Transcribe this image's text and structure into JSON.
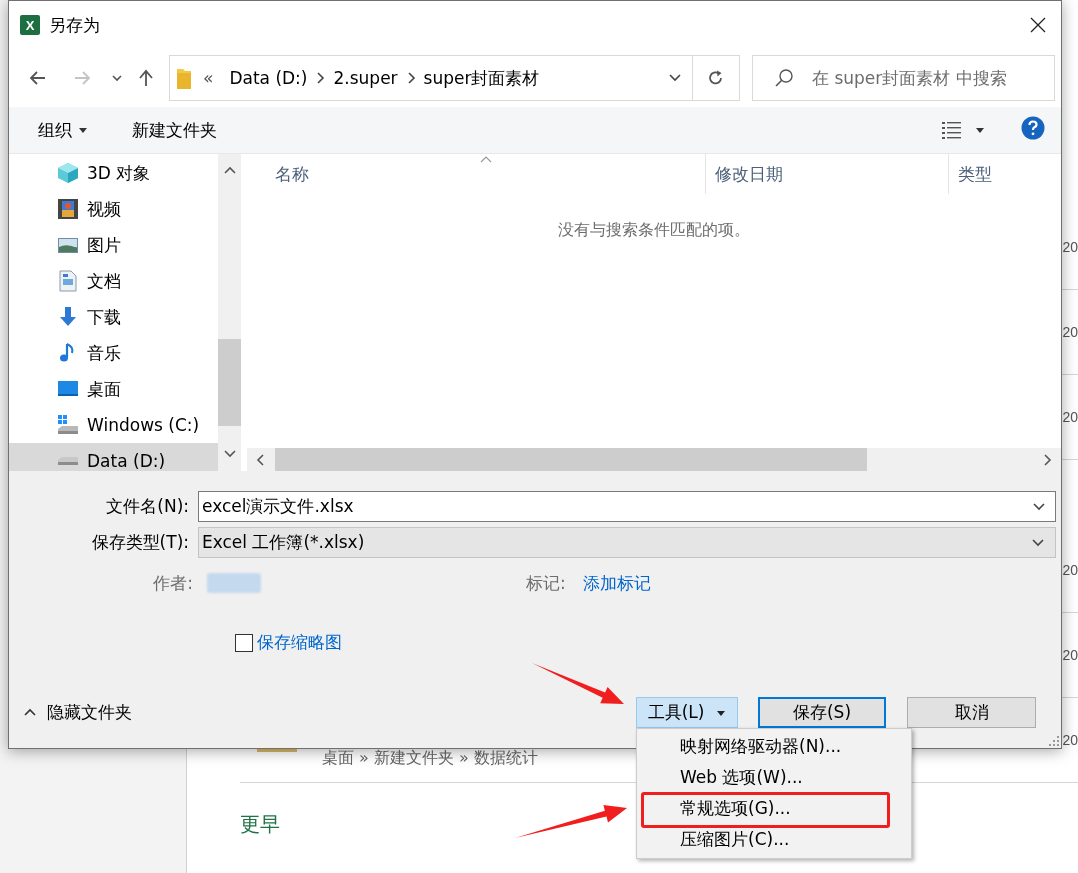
{
  "window": {
    "icon_text": "X",
    "title": "另存为"
  },
  "navigation": [
    {
      "kind": "back",
      "disabled": false
    },
    {
      "kind": "forward",
      "disabled": true
    },
    {
      "kind": "recent",
      "disabled": false
    },
    {
      "kind": "up",
      "disabled": false
    }
  ],
  "address_bar": {
    "overflow": "«",
    "path": [
      "Data (D:)",
      "2.super",
      "super封面素材"
    ]
  },
  "search": {
    "placeholder": "在 super封面素材 中搜索"
  },
  "toolbar": [
    {
      "label": "组织",
      "has_menu": true
    },
    {
      "label": "新建文件夹",
      "has_menu": false
    }
  ],
  "sidebar": {
    "items": [
      {
        "label": "3D 对象",
        "kind": "objects3d",
        "selected": false
      },
      {
        "label": "视频",
        "kind": "videos",
        "selected": false
      },
      {
        "label": "图片",
        "kind": "pictures",
        "selected": false
      },
      {
        "label": "文档",
        "kind": "documents",
        "selected": false
      },
      {
        "label": "下载",
        "kind": "downloads",
        "selected": false
      },
      {
        "label": "音乐",
        "kind": "music",
        "selected": false
      },
      {
        "label": "桌面",
        "kind": "desktop",
        "selected": false
      },
      {
        "label": "Windows (C:)",
        "kind": "system_drive",
        "selected": false
      },
      {
        "label": "Data (D:)",
        "kind": "drive",
        "selected": true
      }
    ]
  },
  "file_list": {
    "columns": [
      {
        "label": "名称",
        "sorted": true
      },
      {
        "label": "修改日期",
        "sorted": false
      },
      {
        "label": "类型",
        "sorted": false
      }
    ],
    "empty_message": "没有与搜索条件匹配的项。"
  },
  "form": {
    "file_name": {
      "label": "文件名(N):",
      "value": "excel演示文件.xlsx"
    },
    "save_type": {
      "label": "保存类型(T):",
      "value": "Excel 工作簿(*.xlsx)"
    },
    "author": {
      "label": "作者:"
    },
    "tags": {
      "label": "标记:",
      "link": "添加标记"
    },
    "thumbnail": {
      "label": "保存缩略图",
      "checked": false
    }
  },
  "footer": {
    "toggle": {
      "label": "隐藏文件夹",
      "expanded": true
    },
    "buttons": [
      {
        "label": "工具(L)",
        "kind": "menu",
        "pressed": true
      },
      {
        "label": "保存(S)",
        "kind": "default",
        "pressed": false
      },
      {
        "label": "取消",
        "kind": "plain",
        "pressed": false
      }
    ]
  },
  "tools_menu": {
    "items": [
      {
        "label": "映射网络驱动器(N)...",
        "annotated": false
      },
      {
        "label": "Web 选项(W)...",
        "annotated": false
      },
      {
        "label": "常规选项(G)...",
        "annotated": true
      },
      {
        "label": "压缩图片(C)...",
        "annotated": false
      }
    ]
  },
  "background": {
    "groups": [
      {
        "rows": [
          {
            "date": "20"
          },
          {
            "date": "20"
          },
          {
            "date": "20"
          }
        ]
      },
      {
        "rows": [
          {
            "date": "20"
          },
          {
            "date": "20"
          },
          {
            "date": "20",
            "path": "桌面 » 新建文件夹 » 数据统计"
          }
        ]
      }
    ],
    "section_heading": "更早"
  }
}
